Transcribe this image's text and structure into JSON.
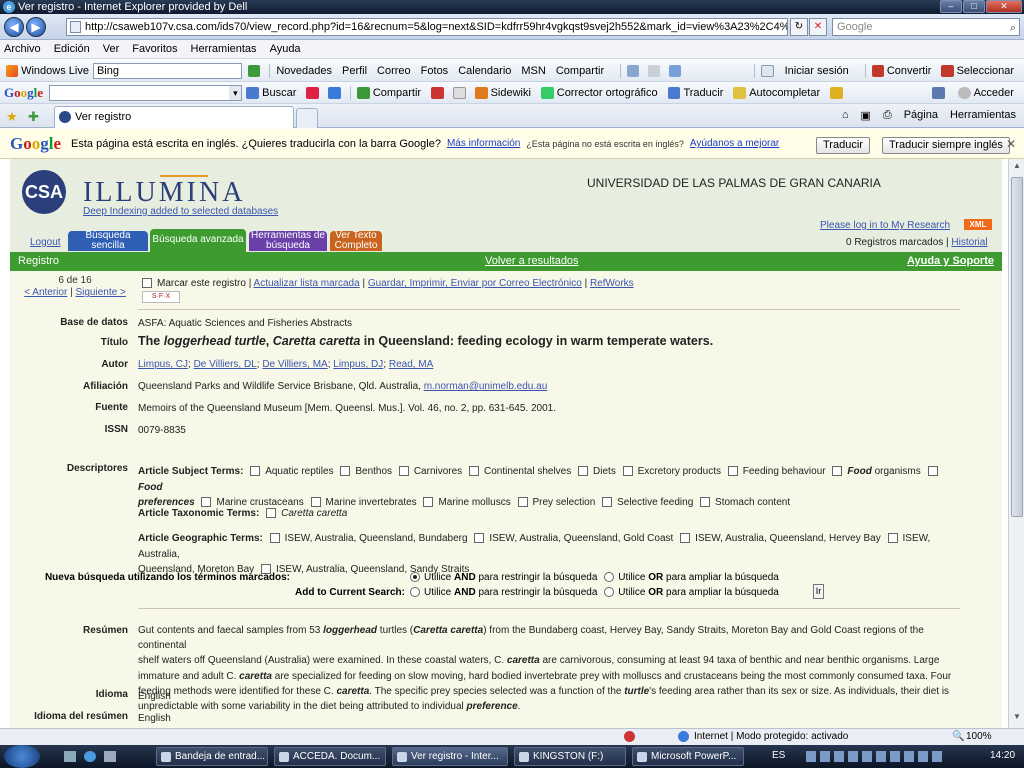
{
  "window": {
    "title": "Ver registro - Internet Explorer provided by Dell"
  },
  "address": {
    "url": "http://csaweb107v.csa.com/ids70/view_record.php?id=16&recnum=5&log=next&SID=kdfrr59hr4vgkqst9svej2h552&mark_id=view%3A23%2C4%2C5",
    "search_placeholder": "Google"
  },
  "menu": [
    "Archivo",
    "Edición",
    "Ver",
    "Favoritos",
    "Herramientas",
    "Ayuda"
  ],
  "wl_toolbar": {
    "brand": "Windows Live",
    "search_value": "Bing",
    "items": [
      "Novedades",
      "Perfil",
      "Correo",
      "Fotos",
      "Calendario",
      "MSN",
      "Compartir"
    ],
    "signin": "Iniciar sesión",
    "convert": "Convertir",
    "select": "Seleccionar"
  },
  "google_toolbar": {
    "brand": "Google",
    "items": [
      "Buscar",
      "Compartir",
      "Sidewiki",
      "Corrector ortográfico",
      "Traducir",
      "Autocompletar"
    ],
    "signin": "Acceder"
  },
  "tabs": {
    "active_label": "Ver registro",
    "tools": [
      "Página",
      "Herramientas"
    ]
  },
  "translate_bar": {
    "message": "Esta página está escrita en inglés. ¿Quieres traducirla con la barra Google?",
    "more_info": "Más información",
    "not_english": "¿Esta página no está escrita en inglés?",
    "help_link": "Ayúdanos a mejorar",
    "translate_btn": "Traducir",
    "always_btn": "Traducir siempre inglés"
  },
  "site": {
    "logo_text": "CSA",
    "brand": "ILLUMINA",
    "deep_link": "Deep Indexing added to selected databases",
    "university": "UNIVERSIDAD DE LAS PALMAS DE GRAN CANARIA",
    "login_link": "Please log in to My Research",
    "xml": "XML",
    "marked": "0 Registros marcados |",
    "history": "Historial",
    "logout": "Logout",
    "search_tabs": [
      "Búsqueda sencilla",
      "Búsqueda avanzada",
      "Herramientas de búsqueda",
      "Ver Texto Completo"
    ],
    "bar": {
      "left": "Registro",
      "center": "Volver a resultados",
      "right": "Ayuda y Soporte"
    },
    "pager": {
      "count": "6 de 16",
      "prev": "< Anterior",
      "sep": "|",
      "next": "Siguiente >"
    },
    "actions": {
      "mark": "Marcar este registro",
      "update": "Actualizar lista marcada",
      "save": "Guardar, Imprimir, Enviar por Correo Electrónico",
      "refworks": "RefWorks",
      "sfx": "S·F·X"
    }
  },
  "record": {
    "labels": {
      "db": "Base de datos",
      "title": "Título",
      "author": "Autor",
      "affil": "Afiliación",
      "source": "Fuente",
      "issn": "ISSN",
      "descriptors": "Descriptores",
      "abstract": "Resúmen",
      "language": "Idioma",
      "abs_lang": "Idioma del resúmen"
    },
    "database": "ASFA: Aquatic Sciences and Fisheries Abstracts",
    "title_parts": [
      "The ",
      "loggerhead turtle",
      ", ",
      "Caretta caretta",
      " in Queensland: feeding ecology in warm temperate waters."
    ],
    "authors": [
      "Limpus, CJ",
      "De Villiers, DL",
      "De Villiers, MA",
      "Limpus, DJ",
      "Read, MA"
    ],
    "affiliation": "Queensland Parks and Wildlife Service Brisbane, Qld. Australia,",
    "affiliation_email": "m.norman@unimelb.edu.au",
    "source": "Memoirs of the Queensland Museum [Mem. Queensl. Mus.]. Vol. 46, no. 2, pp. 631-645. 2001.",
    "issn": "0079-8835",
    "subject_label": "Article Subject Terms:",
    "subject_terms": [
      "Aquatic reptiles",
      "Benthos",
      "Carnivores",
      "Continental shelves",
      "Diets",
      "Excretory products",
      "Feeding behaviour"
    ],
    "food_organisms": [
      "Food",
      " organisms"
    ],
    "food_preferences": [
      "Food",
      "preferences"
    ],
    "subject_terms2": [
      "Marine crustaceans",
      "Marine invertebrates",
      "Marine molluscs",
      "Prey selection",
      "Selective feeding",
      "Stomach content"
    ],
    "taxonomic_label": "Article Taxonomic Terms:",
    "taxonomic_term": "Caretta caretta",
    "geo_label": "Article Geographic Terms:",
    "geo_terms": [
      "ISEW, Australia, Queensland, Bundaberg",
      "ISEW, Australia, Queensland, Gold Coast",
      "ISEW, Australia, Queensland, Hervey Bay",
      "ISEW, Australia,"
    ],
    "geo_terms2": [
      "Queensland, Moreton Bay",
      "ISEW, Australia, Queensland, Sandy Straits"
    ],
    "new_search_label": "Nueva búsqueda utilizando los términos marcados:",
    "add_search_label": "Add to Current Search:",
    "opt_and": [
      "Utilice ",
      "AND",
      " para restringir la búsqueda"
    ],
    "opt_or": [
      "Utilice ",
      "OR",
      " para ampliar la búsqueda"
    ],
    "go_btn": "Ir",
    "abstract_lines": [
      [
        "Gut contents and faecal samples from 53 ",
        "loggerhead",
        " turtles (",
        "Caretta caretta",
        ") from the Bundaberg coast, Hervey Bay, Sandy Straits, Moreton Bay and Gold Coast regions of the continental"
      ],
      [
        "shelf waters off Queensland (Australia) were examined. In these coastal waters, C. ",
        "caretta",
        " are carnivorous, consuming at least 94 taxa of benthic and near benthic organisms. Large"
      ],
      [
        "immature and adult C. ",
        "caretta",
        " are specialized for feeding on slow moving, hard bodied invertebrate prey with molluscs and crustaceans being the most commonly consumed taxa. Four"
      ],
      [
        "feeding methods were identified for these C. ",
        "caretta",
        ". The specific prey species selected was a function of the ",
        "turtle",
        "'s feeding area rather than its sex or size. As individuals, their diet is"
      ],
      [
        "unpredictable with some variability in the diet being attributed to individual ",
        "preference",
        "."
      ]
    ],
    "language": "English",
    "abstract_language": "English"
  },
  "status": {
    "zone": "Internet | Modo protegido: activado",
    "zoom": "100%"
  },
  "taskbar": {
    "buttons": [
      "Bandeja de entrad...",
      "ACCEDA. Docum...",
      "Ver registro - Inter...",
      "KINGSTON (F:)",
      "Microsoft PowerP..."
    ],
    "lang": "ES",
    "time": "14:20"
  },
  "colors": {
    "green_bar": "#3d9b2f",
    "page_bg": "#f8f8e8",
    "header_bg": "#e8eedf",
    "link": "#3a55b0"
  }
}
